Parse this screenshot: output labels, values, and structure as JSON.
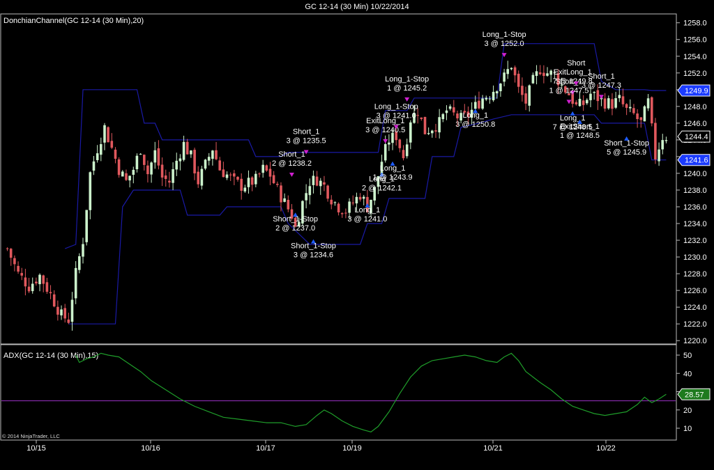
{
  "window_title": "GC 12-14 (30 Min)  10/22/2014",
  "copyright": "© 2014 NinjaTrader, LLC",
  "colors": {
    "background": "#000000",
    "up_candle": "#ccf2cc",
    "down_candle": "#e0585d",
    "donchian": "#1a1aa6",
    "adx_line": "#1f9e2a",
    "adx_ref_line": "#9b30c8",
    "long_marker": "#1e5cff",
    "short_marker": "#d020d0",
    "price_tag_fill": "#1b3bff",
    "adx_tag_fill": "#1e7a1e",
    "last_price_tag_fill": "#000000"
  },
  "chart_data": [
    {
      "type": "candlestick",
      "indicator_label": "DonchianChannel(GC 12-14 (30 Min),20)",
      "x_tick_labels": [
        "10/15",
        "10/16",
        "10/17",
        "10/19",
        "10/21",
        "10/22"
      ],
      "y_tick_labels": [
        "1258.0",
        "1256.0",
        "1254.0",
        "1252.0",
        "1250.0",
        "1248.0",
        "1246.0",
        "1244.0",
        "1242.0",
        "1240.0",
        "1238.0",
        "1236.0",
        "1234.0",
        "1232.0",
        "1230.0",
        "1228.0",
        "1226.0",
        "1224.0",
        "1222.0",
        "1220.0"
      ],
      "ylim": [
        1220,
        1259
      ],
      "price_tags": [
        {
          "label": "1249.9",
          "value": 1249.9,
          "kind": "donchian-upper"
        },
        {
          "label": "1244.4",
          "value": 1244.4,
          "kind": "last-price"
        },
        {
          "label": "1241.6",
          "value": 1241.6,
          "kind": "donchian-lower"
        }
      ],
      "close_path": [
        [
          0,
          1231
        ],
        [
          3,
          1228
        ],
        [
          6,
          1226.5
        ],
        [
          9,
          1227.8
        ],
        [
          12,
          1225.5
        ],
        [
          15,
          1223
        ],
        [
          17,
          1222.5
        ],
        [
          19,
          1228
        ],
        [
          21,
          1232
        ],
        [
          23,
          1240
        ],
        [
          25,
          1243
        ],
        [
          27,
          1245.5
        ],
        [
          29,
          1243
        ],
        [
          31,
          1240.5
        ],
        [
          33,
          1239
        ],
        [
          35,
          1240.5
        ],
        [
          37,
          1243
        ],
        [
          39,
          1240
        ],
        [
          41,
          1242.5
        ],
        [
          43,
          1239.5
        ],
        [
          45,
          1239
        ],
        [
          47,
          1241.5
        ],
        [
          49,
          1243.5
        ],
        [
          51,
          1242
        ],
        [
          53,
          1239
        ],
        [
          55,
          1241
        ],
        [
          57,
          1243
        ],
        [
          59,
          1240.5
        ],
        [
          61,
          1239.8
        ],
        [
          63,
          1239
        ],
        [
          65,
          1238.5
        ],
        [
          67,
          1238.8
        ],
        [
          69,
          1239.2
        ],
        [
          71,
          1240.5
        ],
        [
          73,
          1239.8
        ],
        [
          75,
          1238
        ],
        [
          77,
          1236.5
        ],
        [
          79,
          1235
        ],
        [
          80,
          1233.5
        ],
        [
          82,
          1236.5
        ],
        [
          84,
          1239
        ],
        [
          86,
          1239.3
        ],
        [
          88,
          1238.5
        ],
        [
          90,
          1237
        ],
        [
          92,
          1236
        ],
        [
          94,
          1235.5
        ],
        [
          96,
          1236.5
        ],
        [
          98,
          1237.5
        ],
        [
          100,
          1236
        ],
        [
          102,
          1238
        ],
        [
          104,
          1241.5
        ],
        [
          106,
          1244
        ],
        [
          108,
          1244.5
        ],
        [
          110,
          1242
        ],
        [
          112,
          1246.5
        ],
        [
          114,
          1247.5
        ],
        [
          116,
          1245
        ],
        [
          118,
          1245.5
        ],
        [
          120,
          1246
        ],
        [
          122,
          1247.5
        ],
        [
          124,
          1247
        ],
        [
          126,
          1246.5
        ],
        [
          128,
          1247
        ],
        [
          130,
          1248
        ],
        [
          132,
          1249
        ],
        [
          134,
          1249.5
        ],
        [
          136,
          1250.5
        ],
        [
          138,
          1251.5
        ],
        [
          140,
          1253
        ],
        [
          142,
          1250
        ],
        [
          144,
          1248.5
        ],
        [
          146,
          1251
        ],
        [
          148,
          1252.5
        ],
        [
          150,
          1252
        ],
        [
          152,
          1251.8
        ],
        [
          154,
          1250.5
        ],
        [
          156,
          1249.5
        ],
        [
          158,
          1248
        ],
        [
          160,
          1248.3
        ],
        [
          162,
          1249.5
        ],
        [
          164,
          1249
        ],
        [
          166,
          1248.5
        ],
        [
          168,
          1248.3
        ],
        [
          170,
          1248.8
        ],
        [
          172,
          1247.5
        ],
        [
          174,
          1247
        ],
        [
          176,
          1246
        ],
        [
          178,
          1248.5
        ],
        [
          180,
          1242
        ],
        [
          182,
          1244.4
        ]
      ],
      "donchian_upper": [
        [
          16,
          1231
        ],
        [
          19,
          1231.5
        ],
        [
          21,
          1250
        ],
        [
          36,
          1250
        ],
        [
          38,
          1246
        ],
        [
          41,
          1246
        ],
        [
          43,
          1244
        ],
        [
          67,
          1244
        ],
        [
          69,
          1242
        ],
        [
          76,
          1242
        ],
        [
          78,
          1242.5
        ],
        [
          103,
          1242.5
        ],
        [
          105,
          1247.5
        ],
        [
          111,
          1247.5
        ],
        [
          113,
          1249
        ],
        [
          136,
          1249
        ],
        [
          138,
          1255.5
        ],
        [
          163,
          1255.5
        ],
        [
          165,
          1251
        ],
        [
          169,
          1250
        ],
        [
          177,
          1250
        ],
        [
          179,
          1249.9
        ],
        [
          183,
          1249.9
        ]
      ],
      "donchian_lower": [
        [
          17,
          1222
        ],
        [
          30,
          1222
        ],
        [
          32,
          1236
        ],
        [
          35,
          1238
        ],
        [
          48,
          1238
        ],
        [
          50,
          1235
        ],
        [
          59,
          1235
        ],
        [
          61,
          1236
        ],
        [
          76,
          1236
        ],
        [
          78,
          1234
        ],
        [
          84,
          1231.5
        ],
        [
          98,
          1231.5
        ],
        [
          100,
          1234
        ],
        [
          104,
          1234
        ],
        [
          106,
          1237
        ],
        [
          116,
          1237
        ],
        [
          118,
          1242
        ],
        [
          124,
          1242
        ],
        [
          126,
          1245.5
        ],
        [
          131,
          1246
        ],
        [
          135,
          1246.5
        ],
        [
          140,
          1247
        ],
        [
          163,
          1247
        ],
        [
          165,
          1246
        ],
        [
          177,
          1246
        ],
        [
          179,
          1241.6
        ],
        [
          183,
          1241.6
        ]
      ],
      "trades": [
        {
          "label": "Short_1",
          "sublabel": "3 @ 1235.5",
          "side": "short",
          "bar": 83,
          "price": 1242.2
        },
        {
          "label": "Short_1",
          "sublabel": "2 @ 1238.2",
          "side": "short",
          "bar": 79,
          "price": 1239.5
        },
        {
          "label": "Short_1-Stop",
          "sublabel": "2 @ 1237.0",
          "side": "long",
          "bar": 80,
          "price": 1235.4
        },
        {
          "label": "Short_1-Stop",
          "sublabel": "3 @ 1234.6",
          "side": "long",
          "bar": 85,
          "price": 1232.2
        },
        {
          "label": "Long_1",
          "sublabel": "2 @ 1242.1",
          "side": "long",
          "bar": 104,
          "price": 1240.2
        },
        {
          "label": "Long_1",
          "sublabel": "3 @ 1241.0",
          "side": "long",
          "bar": 100,
          "price": 1236.5
        },
        {
          "label": "ExitLong_1",
          "sublabel": "3 @ 1240.5",
          "side": "short",
          "bar": 105,
          "price": 1243.5
        },
        {
          "label": "Long_1-Stop",
          "sublabel": "3 @ 1241.0",
          "side": "short",
          "bar": 108,
          "price": 1245.2
        },
        {
          "label": "Long_1",
          "sublabel": "1 @ 1243.9",
          "side": "long",
          "bar": 107,
          "price": 1241.5
        },
        {
          "label": "Long_1-Stop",
          "sublabel": "1 @ 1245.2",
          "side": "short",
          "bar": 111,
          "price": 1248.5
        },
        {
          "label": "Long_1",
          "sublabel": "3 @ 1250.8",
          "side": "long",
          "bar": 130,
          "price": 1247.8
        },
        {
          "label": "Long_1-Stop",
          "sublabel": "3 @ 1252.0",
          "side": "short",
          "bar": 138,
          "price": 1253.8
        },
        {
          "label": "ExitLong_1",
          "sublabel": "7 @ 1249.8",
          "side": "short",
          "bar": 157,
          "price": 1249.3
        },
        {
          "label": "Short",
          "sublabel": "",
          "side": "short",
          "bar": 158,
          "price": 1250.4
        },
        {
          "label": "Short_1",
          "sublabel": "1 @ 1247.5",
          "side": "short",
          "bar": 156,
          "price": 1248.2
        },
        {
          "label": "Short_1",
          "sublabel": "3 @ 1247.3",
          "side": "short",
          "bar": 165,
          "price": 1248.8
        },
        {
          "label": "Long_1",
          "sublabel": "7 @ 1248.5",
          "side": "long",
          "bar": 157,
          "price": 1247.5
        },
        {
          "label": "ExitShort_1",
          "sublabel": "1 @ 1248.5",
          "side": "long",
          "bar": 159,
          "price": 1246.5
        },
        {
          "label": "Short_1-Stop",
          "sublabel": "5 @ 1245.9",
          "side": "long",
          "bar": 172,
          "price": 1244.5
        }
      ]
    },
    {
      "type": "line",
      "indicator_label": "ADX(GC 12-14 (30 Min),15)",
      "y_tick_labels": [
        "50",
        "40",
        "30",
        "20",
        "10"
      ],
      "ylim": [
        5,
        55
      ],
      "reference_level": 25,
      "value_tag": {
        "label": "28.57",
        "value": 28.57
      },
      "series": [
        {
          "points": [
            [
              19,
              50
            ],
            [
              20,
              46
            ],
            [
              22,
              48
            ],
            [
              24,
              49
            ],
            [
              26,
              51
            ],
            [
              28,
              50
            ],
            [
              31,
              49
            ],
            [
              34,
              45
            ],
            [
              37,
              41
            ],
            [
              40,
              36
            ],
            [
              44,
              31
            ],
            [
              48,
              26
            ],
            [
              52,
              22
            ],
            [
              56,
              19
            ],
            [
              60,
              16
            ],
            [
              64,
              15
            ],
            [
              68,
              14
            ],
            [
              72,
              13
            ],
            [
              76,
              13
            ],
            [
              80,
              11
            ],
            [
              83,
              12
            ],
            [
              86,
              17
            ],
            [
              88,
              20
            ],
            [
              90,
              18
            ],
            [
              93,
              14
            ],
            [
              96,
              11
            ],
            [
              99,
              9
            ],
            [
              101,
              8
            ],
            [
              103,
              11
            ],
            [
              106,
              19
            ],
            [
              109,
              29
            ],
            [
              112,
              38
            ],
            [
              115,
              44
            ],
            [
              118,
              47
            ],
            [
              121,
              48
            ],
            [
              124,
              49
            ],
            [
              127,
              50
            ],
            [
              130,
              49
            ],
            [
              133,
              47
            ],
            [
              136,
              46
            ],
            [
              138,
              49
            ],
            [
              140,
              51
            ],
            [
              142,
              47
            ],
            [
              144,
              41
            ],
            [
              146,
              38
            ],
            [
              148,
              35
            ],
            [
              151,
              31
            ],
            [
              154,
              26
            ],
            [
              157,
              22
            ],
            [
              160,
              20
            ],
            [
              163,
              18
            ],
            [
              166,
              17
            ],
            [
              169,
              18
            ],
            [
              172,
              19
            ],
            [
              175,
              23
            ],
            [
              177,
              27
            ],
            [
              179,
              24
            ],
            [
              181,
              26
            ],
            [
              183,
              28.57
            ]
          ]
        }
      ]
    }
  ]
}
